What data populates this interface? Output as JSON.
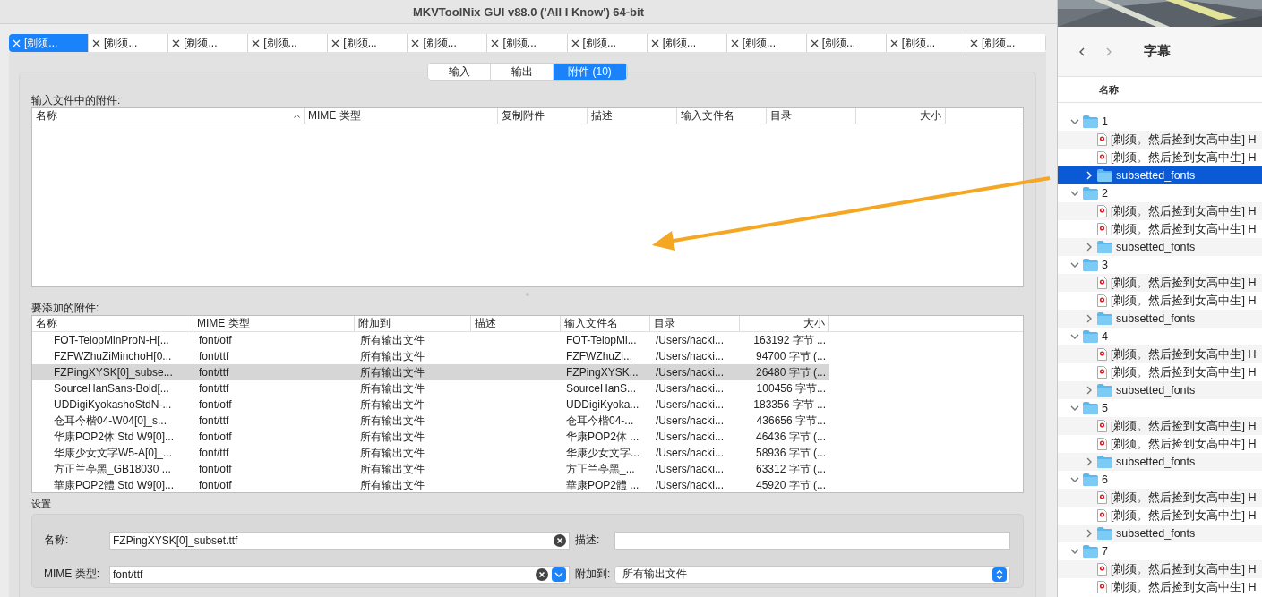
{
  "window": {
    "title": "MKVToolNix GUI v88.0 ('All I Know') 64-bit"
  },
  "file_tabs": [
    {
      "label": "[剃须...",
      "selected": true
    },
    {
      "label": "[剃须...",
      "selected": false
    },
    {
      "label": "[剃须...",
      "selected": false
    },
    {
      "label": "[剃须...",
      "selected": false
    },
    {
      "label": "[剃须...",
      "selected": false
    },
    {
      "label": "[剃须...",
      "selected": false
    },
    {
      "label": "[剃须...",
      "selected": false
    },
    {
      "label": "[剃须...",
      "selected": false
    },
    {
      "label": "[剃须...",
      "selected": false
    },
    {
      "label": "[剃须...",
      "selected": false
    },
    {
      "label": "[剃须...",
      "selected": false
    },
    {
      "label": "[剃须...",
      "selected": false
    },
    {
      "label": "[剃须...",
      "selected": false
    }
  ],
  "section_tabs": [
    {
      "label": "输入",
      "selected": false
    },
    {
      "label": "输出",
      "selected": false
    },
    {
      "label": "附件 (10)",
      "selected": true
    }
  ],
  "input_attachments": {
    "label": "输入文件中的附件:",
    "columns": [
      {
        "label": "名称",
        "sorted": true
      },
      {
        "label": "MIME 类型",
        "sorted": false
      },
      {
        "label": "复制附件",
        "sorted": false
      },
      {
        "label": "描述",
        "sorted": false
      },
      {
        "label": "输入文件名",
        "sorted": false
      },
      {
        "label": "目录",
        "sorted": false
      },
      {
        "label": "大小",
        "sorted": false
      }
    ]
  },
  "new_attachments": {
    "label": "要添加的附件:",
    "columns": [
      "名称",
      "MIME 类型",
      "附加到",
      "描述",
      "输入文件名",
      "目录",
      "大小"
    ],
    "rows": [
      {
        "cells": [
          "FOT-TelopMinProN-H[...",
          "font/otf",
          "所有输出文件",
          "",
          "FOT-TelopMi...",
          "/Users/hacki...",
          "163192 字节 ..."
        ],
        "selected": false
      },
      {
        "cells": [
          "FZFWZhuZiMinchoH[0...",
          "font/ttf",
          "所有输出文件",
          "",
          "FZFWZhuZi...",
          "/Users/hacki...",
          "94700 字节 (..."
        ],
        "selected": false
      },
      {
        "cells": [
          "FZPingXYSK[0]_subse...",
          "font/ttf",
          "所有输出文件",
          "",
          "FZPingXYSK...",
          "/Users/hacki...",
          "26480 字节 (..."
        ],
        "selected": true
      },
      {
        "cells": [
          "SourceHanSans-Bold[...",
          "font/ttf",
          "所有输出文件",
          "",
          "SourceHanS...",
          "/Users/hacki...",
          "100456 字节..."
        ],
        "selected": false
      },
      {
        "cells": [
          "UDDigiKyokashoStdN-...",
          "font/otf",
          "所有输出文件",
          "",
          "UDDigiKyoka...",
          "/Users/hacki...",
          "183356 字节 ..."
        ],
        "selected": false
      },
      {
        "cells": [
          "仓耳今楷04-W04[0]_s...",
          "font/ttf",
          "所有输出文件",
          "",
          "仓耳今楷04-...",
          "/Users/hacki...",
          "436656 字节..."
        ],
        "selected": false
      },
      {
        "cells": [
          "华康POP2体 Std W9[0]...",
          "font/otf",
          "所有输出文件",
          "",
          "华康POP2体 ...",
          "/Users/hacki...",
          "46436 字节 (..."
        ],
        "selected": false
      },
      {
        "cells": [
          "华康少女文字W5-A[0]_...",
          "font/ttf",
          "所有输出文件",
          "",
          "华康少女文字...",
          "/Users/hacki...",
          "58936 字节 (..."
        ],
        "selected": false
      },
      {
        "cells": [
          "方正兰亭黑_GB18030 ...",
          "font/otf",
          "所有输出文件",
          "",
          "方正兰亭黑_...",
          "/Users/hacki...",
          "63312 字节 (..."
        ],
        "selected": false
      },
      {
        "cells": [
          "華康POP2體 Std W9[0]...",
          "font/otf",
          "所有输出文件",
          "",
          "華康POP2體 ...",
          "/Users/hacki...",
          "45920 字节 (..."
        ],
        "selected": false
      }
    ]
  },
  "settings": {
    "label": "设置",
    "name_label": "名称:",
    "name_value": "FZPingXYSK[0]_subset.ttf",
    "description_label": "描述:",
    "mime_label": "MIME 类型:",
    "mime_value": "font/ttf",
    "attach_to_label": "附加到:",
    "attach_to_value": "所有输出文件"
  },
  "finder": {
    "title": "字幕",
    "column": "名称",
    "items": [
      {
        "label": "1",
        "kind": "folder",
        "expanded": true,
        "selected": false,
        "children": [
          {
            "label": "[剃须。然后捡到女高中生] H",
            "kind": "file",
            "selected": false
          },
          {
            "label": "[剃须。然后捡到女高中生] H",
            "kind": "file",
            "selected": false
          },
          {
            "label": "subsetted_fonts",
            "kind": "folder",
            "expanded": false,
            "selected": true
          }
        ]
      },
      {
        "label": "2",
        "kind": "folder",
        "expanded": true,
        "selected": false,
        "children": [
          {
            "label": "[剃须。然后捡到女高中生] H",
            "kind": "file",
            "selected": false
          },
          {
            "label": "[剃须。然后捡到女高中生] H",
            "kind": "file",
            "selected": false
          },
          {
            "label": "subsetted_fonts",
            "kind": "folder",
            "expanded": false,
            "selected": false
          }
        ]
      },
      {
        "label": "3",
        "kind": "folder",
        "expanded": true,
        "selected": false,
        "children": [
          {
            "label": "[剃须。然后捡到女高中生] H",
            "kind": "file",
            "selected": false
          },
          {
            "label": "[剃须。然后捡到女高中生] H",
            "kind": "file",
            "selected": false
          },
          {
            "label": "subsetted_fonts",
            "kind": "folder",
            "expanded": false,
            "selected": false
          }
        ]
      },
      {
        "label": "4",
        "kind": "folder",
        "expanded": true,
        "selected": false,
        "children": [
          {
            "label": "[剃须。然后捡到女高中生] H",
            "kind": "file",
            "selected": false
          },
          {
            "label": "[剃须。然后捡到女高中生] H",
            "kind": "file",
            "selected": false
          },
          {
            "label": "subsetted_fonts",
            "kind": "folder",
            "expanded": false,
            "selected": false
          }
        ]
      },
      {
        "label": "5",
        "kind": "folder",
        "expanded": true,
        "selected": false,
        "children": [
          {
            "label": "[剃须。然后捡到女高中生] H",
            "kind": "file",
            "selected": false
          },
          {
            "label": "[剃须。然后捡到女高中生] H",
            "kind": "file",
            "selected": false
          },
          {
            "label": "subsetted_fonts",
            "kind": "folder",
            "expanded": false,
            "selected": false
          }
        ]
      },
      {
        "label": "6",
        "kind": "folder",
        "expanded": true,
        "selected": false,
        "children": [
          {
            "label": "[剃须。然后捡到女高中生] H",
            "kind": "file",
            "selected": false
          },
          {
            "label": "[剃须。然后捡到女高中生] H",
            "kind": "file",
            "selected": false
          },
          {
            "label": "subsetted_fonts",
            "kind": "folder",
            "expanded": false,
            "selected": false
          }
        ]
      },
      {
        "label": "7",
        "kind": "folder",
        "expanded": true,
        "selected": false,
        "children": [
          {
            "label": "[剃须。然后捡到女高中生] H",
            "kind": "file",
            "selected": false
          },
          {
            "label": "[剃须。然后捡到女高中生] H",
            "kind": "file",
            "selected": false
          }
        ]
      }
    ]
  }
}
